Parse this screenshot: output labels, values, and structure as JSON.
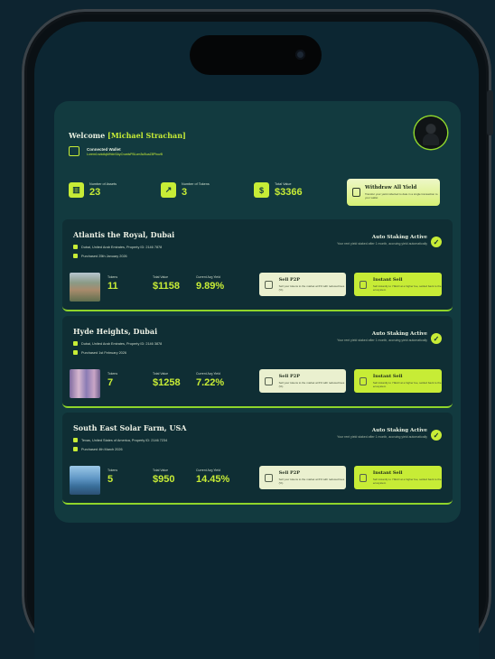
{
  "header": {
    "welcome_prefix": "Welcome",
    "user_name": "[Michael Strachan]",
    "wallet_title": "Connected Wallet",
    "wallet_address": "Lorem1nzkdiqMHdnSAyCvwdsPBLcm3uBuaZ8PhuvB"
  },
  "stats": [
    {
      "label": "Number of Assets",
      "value": "23",
      "icon": "building-icon"
    },
    {
      "label": "Number of Tokens",
      "value": "3",
      "icon": "token-icon"
    },
    {
      "label": "Total Value",
      "value": "$3366",
      "icon": "money-bag-icon"
    }
  ],
  "withdraw": {
    "title": "Withdraw All Yield",
    "desc": "Transfer your yield collected to date in a single transaction to your wallet"
  },
  "properties": [
    {
      "name": "Atlantis the Royal, Dubai",
      "location": "Dubai, United Arab Emirates, Property ID: 2146 7878",
      "purchased": "Purchased 25th January 2026",
      "staking_title": "Auto Staking Active",
      "staking_desc": "Your rent yield staked after 1 month, accruing yield automatically",
      "tokens_label": "Tokens",
      "tokens": "11",
      "value_label": "Total Value",
      "value": "$1158",
      "yield_label": "Current Avg Yield",
      "yield": "9.89%",
      "sell_title": "Sell P2P",
      "sell_desc": "Sell your tokens to the market at 6% with reduced fees (%)",
      "instant_title": "Instant Sell",
      "instant_desc": "Sell instantly to YIELD at a higher fee, settled back to the ecosystem"
    },
    {
      "name": "Hyde Heights, Dubai",
      "location": "Dubai, United Arab Emirates, Property ID: 2146 3878",
      "purchased": "Purchased 1st February 2026",
      "staking_title": "Auto Staking Active",
      "staking_desc": "Your rent yield staked after 1 month, accruing yield automatically",
      "tokens_label": "Tokens",
      "tokens": "7",
      "value_label": "Total Value",
      "value": "$1258",
      "yield_label": "Current Avg Yield",
      "yield": "7.22%",
      "sell_title": "Sell P2P",
      "sell_desc": "Sell your tokens to the market at 6% with reduced fees (%)",
      "instant_title": "Instant Sell",
      "instant_desc": "Sell instantly to YIELD at a higher fee, settled back to the ecosystem"
    },
    {
      "name": "South East Solar Farm, USA",
      "location": "Texas, United States of America, Property ID: 2146 7234",
      "purchased": "Purchased 4th March 2026",
      "staking_title": "Auto Staking Active",
      "staking_desc": "Your rent yield staked after 1 month, accruing yield automatically",
      "tokens_label": "Tokens",
      "tokens": "5",
      "value_label": "Total Value",
      "value": "$950",
      "yield_label": "Current Avg Yield",
      "yield": "14.45%",
      "sell_title": "Sell P2P",
      "sell_desc": "Sell your tokens to the market at 6% with reduced fees (%)",
      "instant_title": "Instant Sell",
      "instant_desc": "Sell instantly to YIELD at a higher fee, settled back to the ecosystem"
    }
  ],
  "colors": {
    "accent": "#c7ec36",
    "panel": "#123a3f",
    "background": "#0d2430"
  }
}
